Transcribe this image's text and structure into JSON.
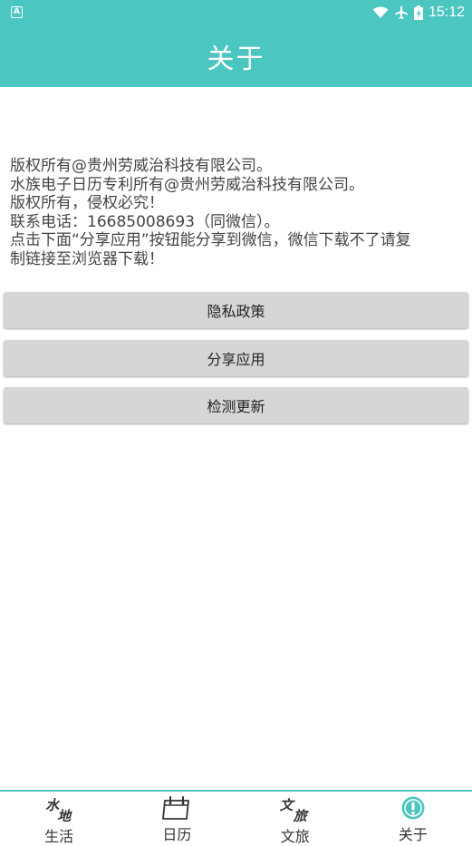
{
  "status_bar": {
    "app_icon_letter": "A",
    "time": "15:12"
  },
  "app_bar": {
    "title": "关于"
  },
  "info": {
    "lines": [
      "版权所有@贵州劳威治科技有限公司。",
      "水族电子日历专利所有@贵州劳威治科技有限公司。",
      "版权所有，侵权必究！",
      "联系电话：16685008693（同微信）。",
      "点击下面“分享应用”按钮能分享到微信，微信下载不了请复",
      "制链接至浏览器下载！"
    ]
  },
  "buttons": {
    "privacy": "隐私政策",
    "share": "分享应用",
    "update": "检测更新"
  },
  "nav": {
    "items": [
      {
        "label": "生活",
        "icon": "life-calligraphy-icon",
        "glyph_a": "水",
        "glyph_b": "地"
      },
      {
        "label": "日历",
        "icon": "calendar-icon"
      },
      {
        "label": "文旅",
        "icon": "culture-travel-calligraphy-icon",
        "glyph_a": "文",
        "glyph_b": "旅"
      },
      {
        "label": "关于",
        "icon": "info-icon"
      }
    ],
    "active_color": "#4cc6c0"
  },
  "colors": {
    "primary": "#4cc6c0",
    "button_bg": "#d6d6d6",
    "text": "#444444"
  }
}
